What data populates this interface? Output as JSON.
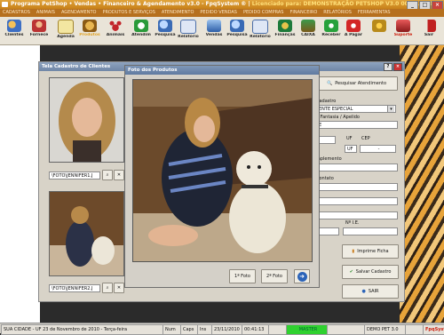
{
  "titlebar": {
    "title": "Programa PetShop • Vendas • Financeiro & Agendamento v3.0 - FpqSystem ®",
    "license": "Licenciado para: DEMONSTRAÇÃO PETSHOP V3.0 000111 00011"
  },
  "menu": [
    "CADASTROS",
    "ANIMAIS",
    "AGENDAMENTO",
    "PRODUTOS E SERVIÇOS",
    "ATENDIMENTO",
    "PEDIDO VENDAS",
    "PEDIDO COMPRAS",
    "FINANCEIRO",
    "RELATÓRIOS",
    "FERRAMENTAS"
  ],
  "toolbar": [
    "Clientes",
    "Fornece",
    "Agenda",
    "Produtos",
    "Animais",
    "Atendim",
    "Pesquisa",
    "Relatório",
    "Vendas",
    "Pesquisa",
    "Relatório",
    "Finanças",
    "CAIXA",
    "Receber",
    "A Pagar",
    "",
    "Suporte",
    "Sair"
  ],
  "clients": {
    "title": "Tela Cadastro de Clientes",
    "photo1_path": "\\FOTO\\JENNIFER1.J",
    "photo2_path": "\\FOTO\\JENNIFER2.J",
    "search_btn": "Pesquisar Atendimento",
    "cadastro_label": "Cadastro",
    "cadastro_value": "ENTE ESPECIAL",
    "fantasia_label": "e Fantasia / Apelido",
    "fantasia_value": "E",
    "uf_label": "UF",
    "uf_value": "UF",
    "cep_label": "CEP",
    "cep_value": "-",
    "complemento_label": "mplemento",
    "contato_label": "Contato",
    "ie_label": "Nº I.E.",
    "print_btn": "Imprime Ficha",
    "save_btn": "Salvar Cadastro",
    "exit_btn": "SAIR"
  },
  "product_dialog": {
    "title": "Foto dos Produtos",
    "btn1": "1ª Foto",
    "btn2": "2ª Foto"
  },
  "status": {
    "city": "SUA CIDADE - UF 23 de Novembro de 2010 - Terça-feira",
    "num": "Num",
    "caps": "Caps",
    "ins": "Ins",
    "date": "23/11/2010",
    "time": "00:41:13",
    "master": "MASTER",
    "demo": "DEMO PET 3.0",
    "brand": "FpqSystem"
  },
  "colors": {
    "title_orange": "#c8811a",
    "window_blue": "#6f86a6",
    "save_green": "#2e8b2e",
    "exit_blue": "#2b63b8",
    "master_green": "#2fd12f"
  }
}
